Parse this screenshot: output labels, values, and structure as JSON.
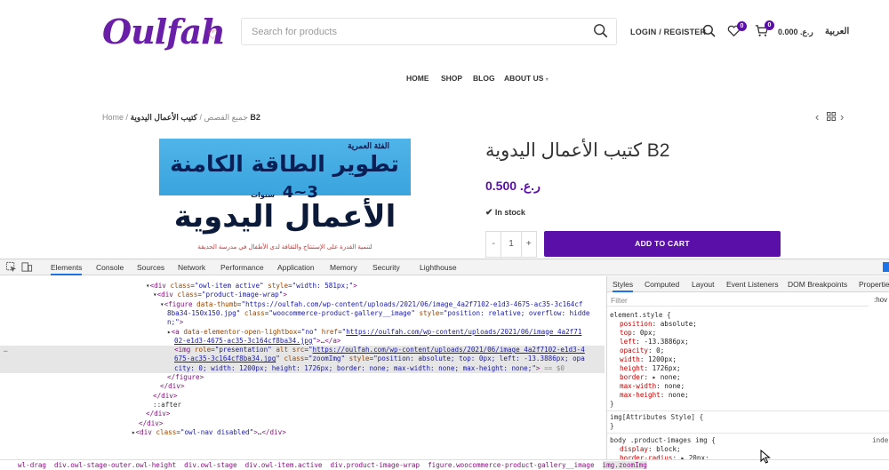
{
  "site": {
    "logo_text": "Oulfah",
    "search_placeholder": "Search for products",
    "login_label": "LOGIN / REGISTER",
    "wishlist_count": "0",
    "cart_count": "0",
    "cart_total": "0.000 .ر.ع",
    "language_label": "العربية",
    "nav": [
      "HOME",
      "SHOP",
      "BLOG",
      "ABOUT US"
    ],
    "breadcrumb": {
      "home": "Home",
      "sep": "/",
      "category": "جميع القصص",
      "current": "كتيب الأعمال اليدوية B2"
    },
    "product": {
      "title": "كتيب الأعمال اليدوية B2",
      "price": "0.500 .ر.ع",
      "stock": "In stock",
      "qty_minus": "-",
      "qty_value": "1",
      "qty_plus": "+",
      "add_to_cart": "ADD TO CART",
      "image_text": {
        "age": "الفئة العمرية",
        "age_range": "3~4",
        "years": "سنوات",
        "headline": "تطوير الطاقة الكامنة",
        "subject": "الأعمال اليدوية",
        "footer": "لتنمية القدرة على الإستنتاج والثقافة لدى الأطفال في مدرسة الحديقة"
      }
    }
  },
  "devtools": {
    "tabs": [
      "Elements",
      "Console",
      "Sources",
      "Network",
      "Performance",
      "Application",
      "Memory",
      "Security",
      "Lighthouse"
    ],
    "active_tab": "Elements",
    "dom_lines": [
      {
        "indent": 164,
        "html": "▾<span class=\"tg\">&lt;div</span> <span class=\"at\">class</span>=<span class=\"av\">\"owl-item active\"</span> <span class=\"at\">style</span>=<span class=\"av\">\"width: 581px;\"</span><span class=\"tg\">&gt;</span>"
      },
      {
        "indent": 172,
        "html": "▾<span class=\"tg\">&lt;div</span> <span class=\"at\">class</span>=<span class=\"av\">\"product-image-wrap\"</span><span class=\"tg\">&gt;</span>"
      },
      {
        "indent": 180,
        "html": "▾<span class=\"tg\">&lt;figure</span> <span class=\"at\">data-thumb</span>=<span class=\"av\">\"https://oulfah.com/wp-content/uploads/2021/06/image_4a2f7102-e1d3-4675-ac35-3c164cf</span>"
      },
      {
        "indent": 188,
        "html": "<span class=\"av\">8ba34-150x150.jpg\"</span> <span class=\"at\">class</span>=<span class=\"av\">\"woocommerce-product-gallery__image\"</span> <span class=\"at\">style</span>=<span class=\"av\">\"position: relative; overflow: hidde</span>"
      },
      {
        "indent": 188,
        "html": "<span class=\"av\">n;\"</span><span class=\"tg\">&gt;</span>"
      },
      {
        "indent": 188,
        "html": "▸<span class=\"tg\">&lt;a</span> <span class=\"at\">data-elementor-open-lightbox</span>=<span class=\"av\">\"no\"</span> <span class=\"at\">href</span>=<span class=\"av\">\"</span><span class=\"lk\">https://oulfah.com/wp-content/uploads/2021/06/image_4a2f71</span>"
      },
      {
        "indent": 196,
        "html": "<span class=\"lk\">02-e1d3-4675-ac35-3c164cf8ba34.jpg</span><span class=\"av\">\"</span><span class=\"tg\">&gt;</span>…<span class=\"tg\">&lt;/a&gt;</span>"
      },
      {
        "indent": 196,
        "html": "<span class=\"tg\">&lt;img</span> <span class=\"at\">role</span>=<span class=\"av\">\"presentation\"</span> <span class=\"at\">alt</span> <span class=\"at\">src</span>=<span class=\"av\">\"</span><span class=\"lk\">https://oulfah.com/wp-content/uploads/2021/06/image_4a2f7102-e1d3-4</span>",
        "hl": true
      },
      {
        "indent": 196,
        "html": "<span class=\"lk\">675-ac35-3c164cf8ba34.jpg</span><span class=\"av\">\"</span> <span class=\"at\">class</span>=<span class=\"av\">\"zoomImg\"</span> <span class=\"at\">style</span>=<span class=\"av\">\"position: absolute; top: 0px; left: -13.3886px; opa</span>",
        "hl": true
      },
      {
        "indent": 196,
        "html": "<span class=\"av\">city: 0; width: 1200px; height: 1726px; border: none; max-width: none; max-height: none;\"</span><span class=\"tg\">&gt;</span> <span class=\"gy\">== $0</span>",
        "hl": true
      },
      {
        "indent": 188,
        "html": "<span class=\"tg\">&lt;/figure&gt;</span>"
      },
      {
        "indent": 180,
        "html": "<span class=\"tg\">&lt;/div&gt;</span>"
      },
      {
        "indent": 172,
        "html": "<span class=\"tg\">&lt;/div&gt;</span>"
      },
      {
        "indent": 172,
        "html": "<span class=\"pl\">::after</span>"
      },
      {
        "indent": 164,
        "html": "<span class=\"tg\">&lt;/div&gt;</span>"
      },
      {
        "indent": 156,
        "html": "<span class=\"tg\">&lt;/div&gt;</span>"
      },
      {
        "indent": 148,
        "html": "▸<span class=\"tg\">&lt;div</span> <span class=\"at\">class</span>=<span class=\"av\">\"owl-nav disabled\"</span><span class=\"tg\">&gt;</span>…<span class=\"tg\">&lt;/div&gt;</span>"
      }
    ],
    "breadcrumb_path": [
      "wl-drag",
      "div.owl-stage-outer.owl-height",
      "div.owl-stage",
      "div.owl-item.active",
      "div.product-image-wrap",
      "figure.woocommerce-product-gallery__image",
      "img.zoomImg"
    ],
    "styles": {
      "tabs": [
        "Styles",
        "Computed",
        "Layout",
        "Event Listeners",
        "DOM Breakpoints",
        "Properties"
      ],
      "filter_placeholder": "Filter",
      "hov_label": ":hov",
      "element_style_selector": "element.style {",
      "element_style_props": [
        "position: absolute;",
        "top: 0px;",
        "left: -13.3886px;",
        "opacity: 0;",
        "width: 1200px;",
        "height: 1726px;",
        "border: ▸ none;",
        "max-width: none;",
        "max-height: none;"
      ],
      "close_brace": "}",
      "attr_rule": "img[Attributes Style] {",
      "attr_close": "}",
      "rule3_selector": "body .product-images img {",
      "rule3_source": "inde",
      "rule3_props": [
        "display: block;",
        "border-radius: ▸ 20px;"
      ]
    }
  }
}
